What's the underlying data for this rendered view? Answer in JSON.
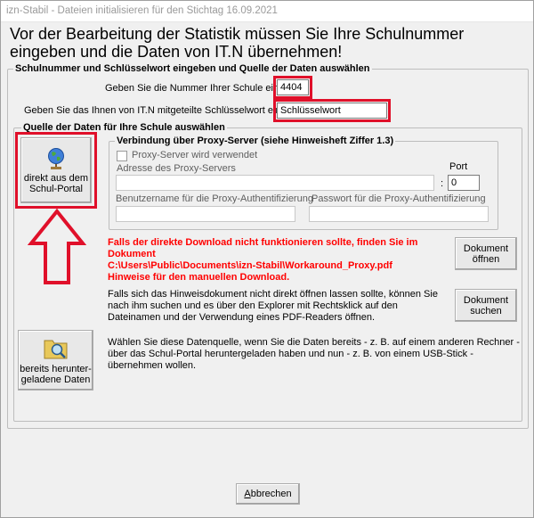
{
  "window": {
    "title": "izn-Stabil - Dateien initialisieren für den Stichtag 16.09.2021"
  },
  "headline": "Vor der Bearbeitung der Statistik müssen Sie Ihre Schulnummer eingeben und die Daten von IT.N übernehmen!",
  "credentials": {
    "group_title": "Schulnummer und Schlüsselwort eingeben und Quelle der Daten auswählen",
    "school_number_label": "Geben Sie die Nummer Ihrer Schule ein:",
    "school_number_value": "4404",
    "keyword_label": "Geben Sie das Ihnen von IT.N mitgeteilte Schlüsselwort ein:",
    "keyword_value": "Schlüsselwort"
  },
  "source": {
    "group_title": "Quelle der Daten für Ihre Schule auswählen",
    "portal_button_label": "direkt aus dem\nSchul-Portal",
    "downloaded_button_label": "bereits herunter-\ngeladene Daten",
    "downloaded_description": "Wählen Sie diese Datenquelle, wenn Sie die Daten bereits - z. B. auf einem anderen Rechner - über das Schul-Portal heruntergeladen haben und nun - z. B. von einem USB-Stick - übernehmen wollen."
  },
  "proxy": {
    "group_title": "Verbindung über Proxy-Server (siehe Hinweisheft Ziffer 1.3)",
    "checkbox_label": "Proxy-Server wird verwendet",
    "address_label": "Adresse des Proxy-Servers",
    "port_label": "Port",
    "port_separator": ":",
    "port_value": "0",
    "username_label": "Benutzername für die Proxy-Authentifizierung",
    "password_label": "Passwort für die Proxy-Authentifizierung"
  },
  "hints": {
    "red_lines": [
      "Falls der direkte Download nicht funktionieren sollte, finden Sie im",
      "Dokument",
      "C:\\Users\\Public\\Documents\\izn-Stabil\\Workaround_Proxy.pdf",
      "Hinweise für den manuellen Download."
    ],
    "open_doc_button": "Dokument\nöffnen",
    "search_text": "Falls sich das Hinweisdokument nicht direkt öffnen lassen sollte, können Sie nach ihm suchen und es über den Explorer mit Rechtsklick auf den Dateinamen und der Verwendung eines PDF-Readers öffnen.",
    "search_doc_button": "Dokument\nsuchen"
  },
  "footer": {
    "cancel_label_underlined": "A",
    "cancel_label_rest": "bbrechen"
  },
  "colors": {
    "highlight": "#e0102a",
    "hint_red": "#ff0000",
    "arrow": "#e0102a"
  }
}
